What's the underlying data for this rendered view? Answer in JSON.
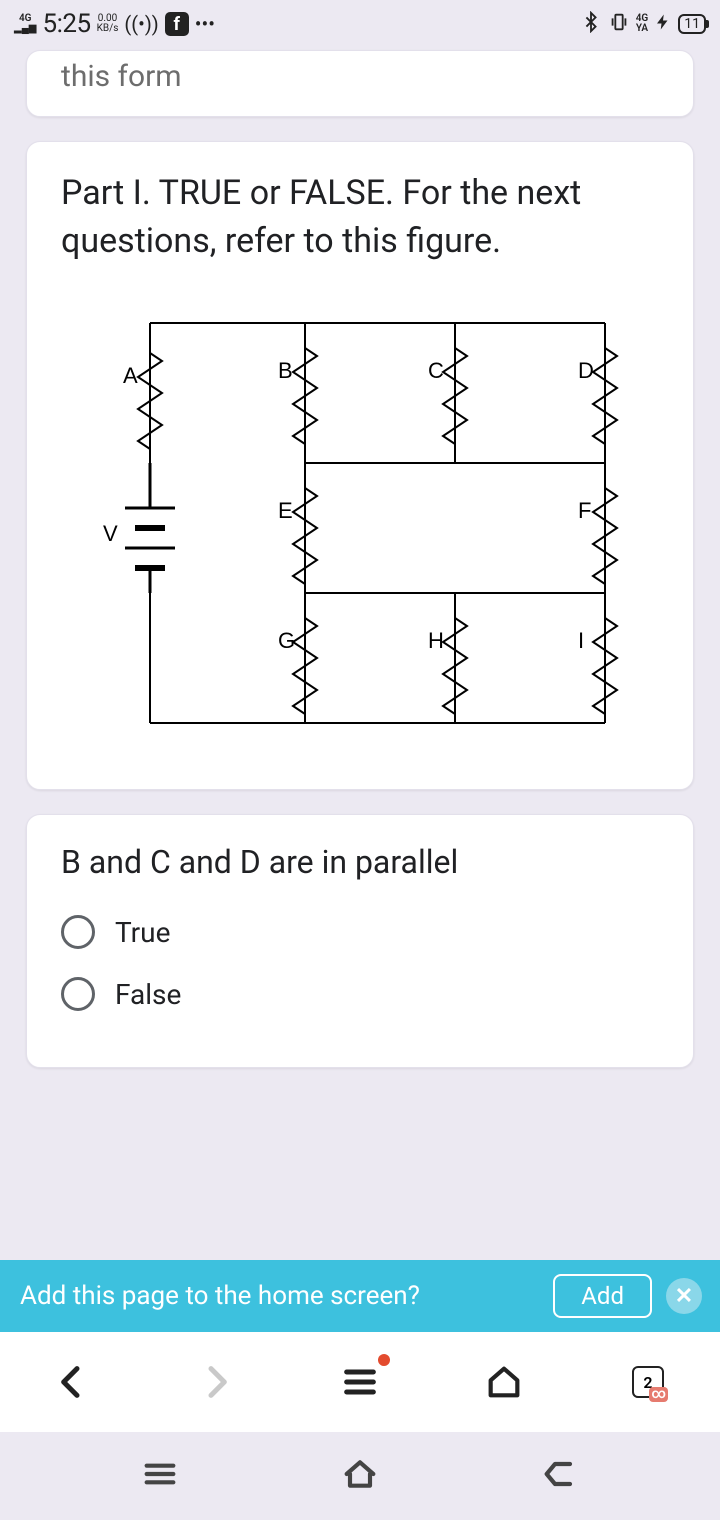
{
  "status": {
    "network": "4G",
    "time": "5:25",
    "speed_val": "0.00",
    "speed_unit": "KB/s",
    "ya_top": "4G",
    "ya_bot": "YA",
    "battery": "11"
  },
  "top_card": {
    "text": "this form"
  },
  "part_card": {
    "heading": "Part I. TRUE or FALSE. For the next questions, refer to this figure.",
    "labels": {
      "A": "A",
      "B": "B",
      "C": "C",
      "D": "D",
      "E": "E",
      "F": "F",
      "G": "G",
      "H": "H",
      "I": "I",
      "V": "V"
    }
  },
  "question_card": {
    "question": "B and C and D are in parallel",
    "options": [
      "True",
      "False"
    ]
  },
  "snackbar": {
    "text": "Add this page to the home screen?",
    "action": "Add"
  },
  "browser": {
    "tabs_count": "2"
  }
}
